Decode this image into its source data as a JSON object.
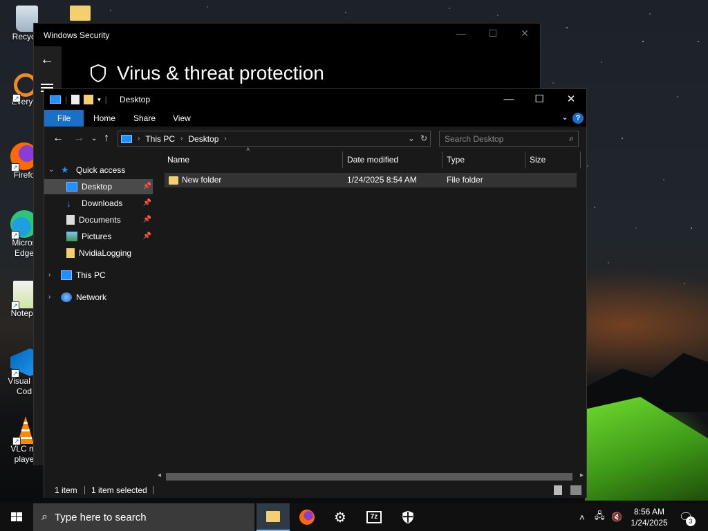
{
  "desktop": {
    "icons": [
      {
        "label": "Recycle"
      },
      {
        "label": "Everyth"
      },
      {
        "label": "Firefo"
      },
      {
        "label": "Micros Edge"
      },
      {
        "label": "Notepa"
      },
      {
        "label": "Visual St Cod"
      },
      {
        "label": "VLC me player"
      }
    ]
  },
  "security_window": {
    "title": "Windows Security",
    "heading": "Virus & threat protection"
  },
  "explorer": {
    "title": "Desktop",
    "ribbon_tabs": {
      "file": "File",
      "home": "Home",
      "share": "Share",
      "view": "View"
    },
    "address": {
      "crumb1": "This PC",
      "crumb2": "Desktop"
    },
    "search_placeholder": "Search Desktop",
    "nav": {
      "quick_access": "Quick access",
      "desktop": "Desktop",
      "downloads": "Downloads",
      "documents": "Documents",
      "pictures": "Pictures",
      "nvidia": "NvidiaLogging",
      "this_pc": "This PC",
      "network": "Network"
    },
    "columns": {
      "name": "Name",
      "date": "Date modified",
      "type": "Type",
      "size": "Size"
    },
    "files": [
      {
        "name": "New folder",
        "date": "1/24/2025 8:54 AM",
        "type": "File folder",
        "size": ""
      }
    ],
    "status": {
      "count": "1 item",
      "selected": "1 item selected"
    }
  },
  "taskbar": {
    "search_placeholder": "Type here to search",
    "time": "8:56 AM",
    "date": "1/24/2025",
    "notification_count": "3"
  },
  "colors": {
    "accent": "#1a6fc7",
    "folder": "#f4cf6d",
    "window_bg": "#191919",
    "selection": "#4a4a4a"
  }
}
